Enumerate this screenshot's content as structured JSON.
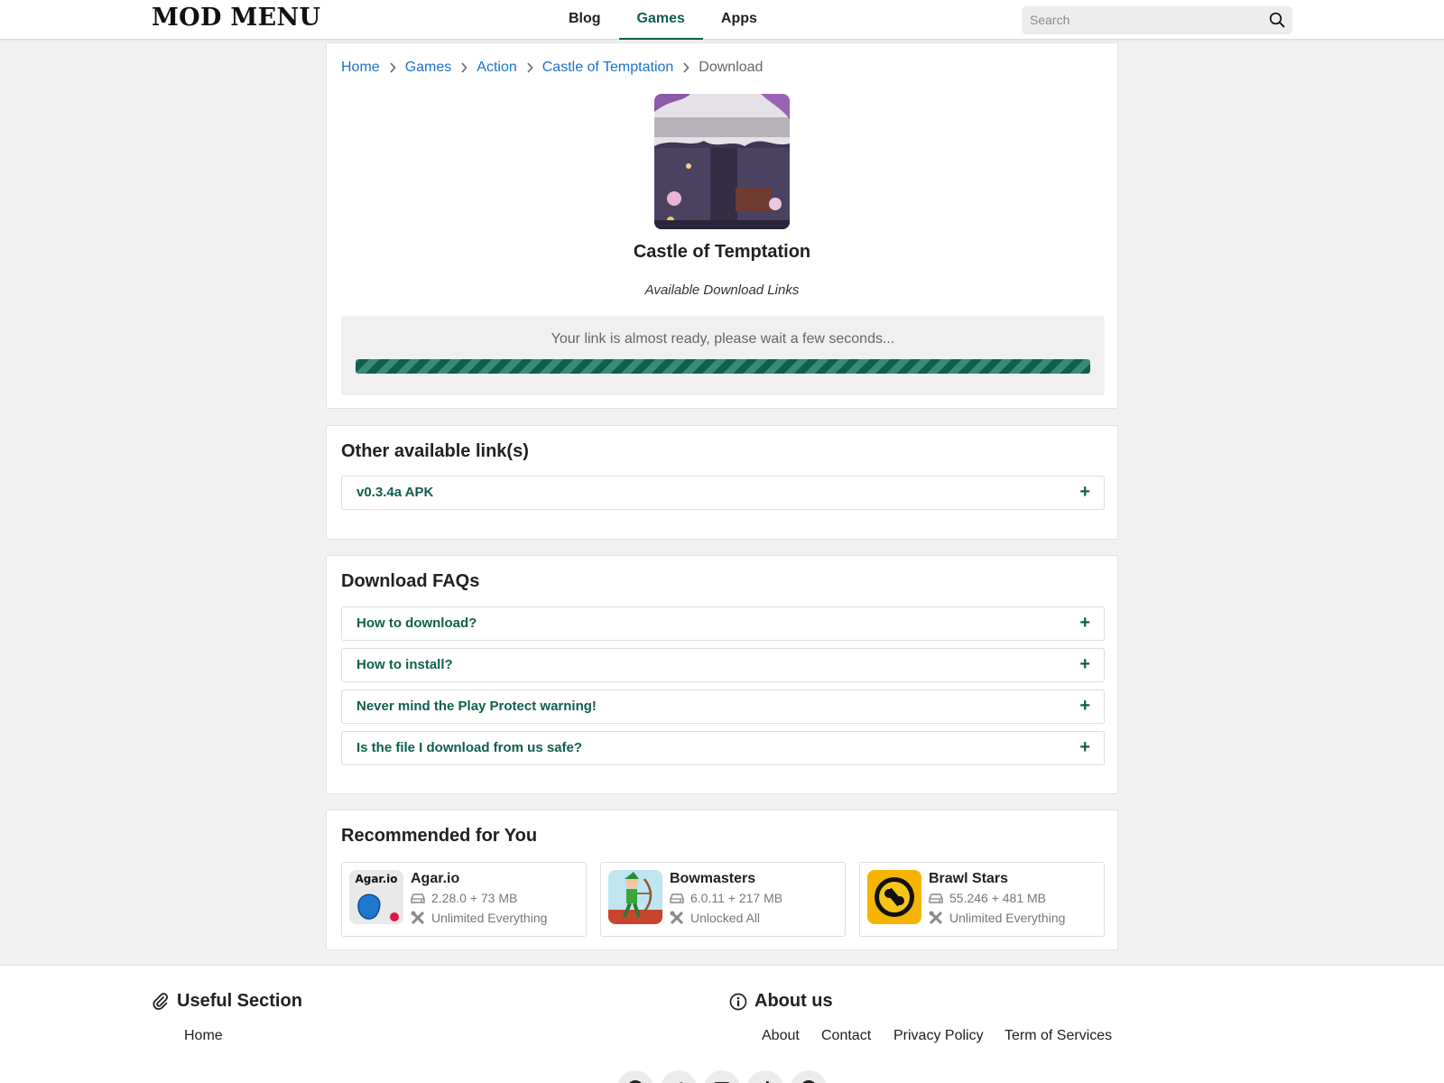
{
  "header": {
    "logo": "MOD MENU",
    "nav": [
      {
        "label": "Blog",
        "active": false
      },
      {
        "label": "Games",
        "active": true
      },
      {
        "label": "Apps",
        "active": false
      }
    ],
    "search": {
      "placeholder": "Search"
    }
  },
  "breadcrumb": [
    "Home",
    "Games",
    "Action",
    "Castle of Temptation",
    "Download"
  ],
  "app": {
    "title": "Castle of Temptation",
    "available": "Available Download Links",
    "wait_text": "Your link is almost ready, please wait a few seconds...",
    "progress": 1.0
  },
  "other_links": {
    "title": "Other available link(s)",
    "items": [
      "v0.3.4a APK"
    ]
  },
  "faqs": {
    "title": "Download FAQs",
    "items": [
      "How to download?",
      "How to install?",
      "Never mind the Play Protect warning!",
      "Is the file I download from us safe?"
    ]
  },
  "recommended": {
    "title": "Recommended for You",
    "items": [
      {
        "name": "Agar.io",
        "version": "2.28.0 + 73 MB",
        "mod": "Unlimited Everything",
        "thumb_label": "Agar.io"
      },
      {
        "name": "Bowmasters",
        "version": "6.0.11 + 217 MB",
        "mod": "Unlocked All"
      },
      {
        "name": "Brawl Stars",
        "version": "55.246 + 481 MB",
        "mod": "Unlimited Everything"
      }
    ]
  },
  "footer": {
    "useful_title": "Useful Section",
    "useful_links": [
      "Home"
    ],
    "about_title": "About us",
    "about_links": [
      "About",
      "Contact",
      "Privacy Policy",
      "Term of Services"
    ],
    "social_icons": [
      "facebook-icon",
      "twitter-icon",
      "youtube-icon",
      "tiktok-icon",
      "pinterest-icon"
    ]
  },
  "colors": {
    "accent": "#0f5e4e",
    "link": "#1a73c8",
    "background": "#f2f2f2"
  }
}
